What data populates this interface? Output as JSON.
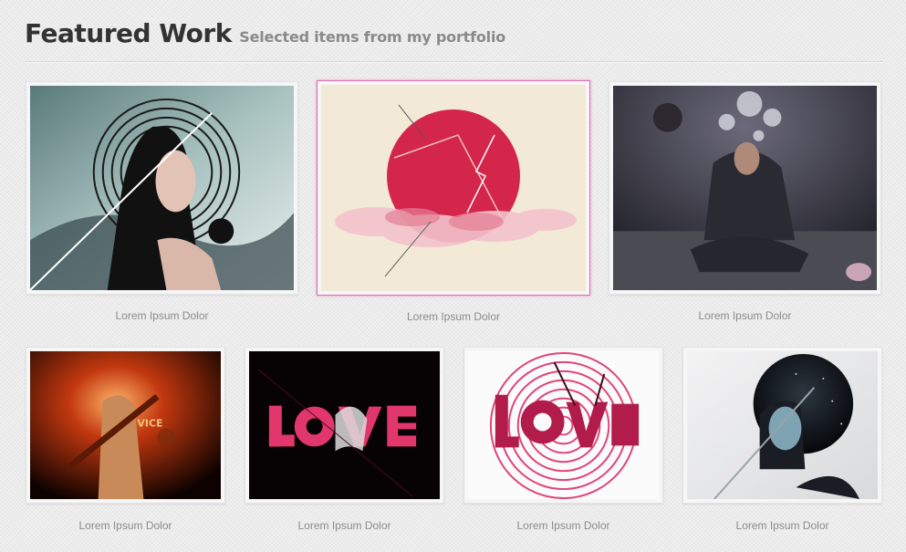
{
  "header": {
    "title": "Featured Work",
    "subtitle": "Selected items from my portfolio"
  },
  "portfolio": {
    "row1": [
      {
        "caption": "Lorem Ipsum Dolor",
        "icon": "portrait-woman-circles-artwork"
      },
      {
        "caption": "Lorem Ipsum Dolor",
        "icon": "red-sun-clouds-artwork",
        "active": true
      },
      {
        "caption": "Lorem Ipsum Dolor",
        "icon": "praying-man-explosion-artwork"
      }
    ],
    "row2": [
      {
        "caption": "Lorem Ipsum Dolor",
        "icon": "fire-woman-bat-artwork"
      },
      {
        "caption": "Lorem Ipsum Dolor",
        "icon": "love-typography-dark-artwork"
      },
      {
        "caption": "Lorem Ipsum Dolor",
        "icon": "love-typography-rings-artwork"
      },
      {
        "caption": "Lorem Ipsum Dolor",
        "icon": "woman-space-circle-artwork"
      }
    ]
  },
  "colors": {
    "accent": "#e06ab4",
    "title": "#333333",
    "subtitle": "#8a8a8a",
    "caption": "#8c8c8c"
  }
}
